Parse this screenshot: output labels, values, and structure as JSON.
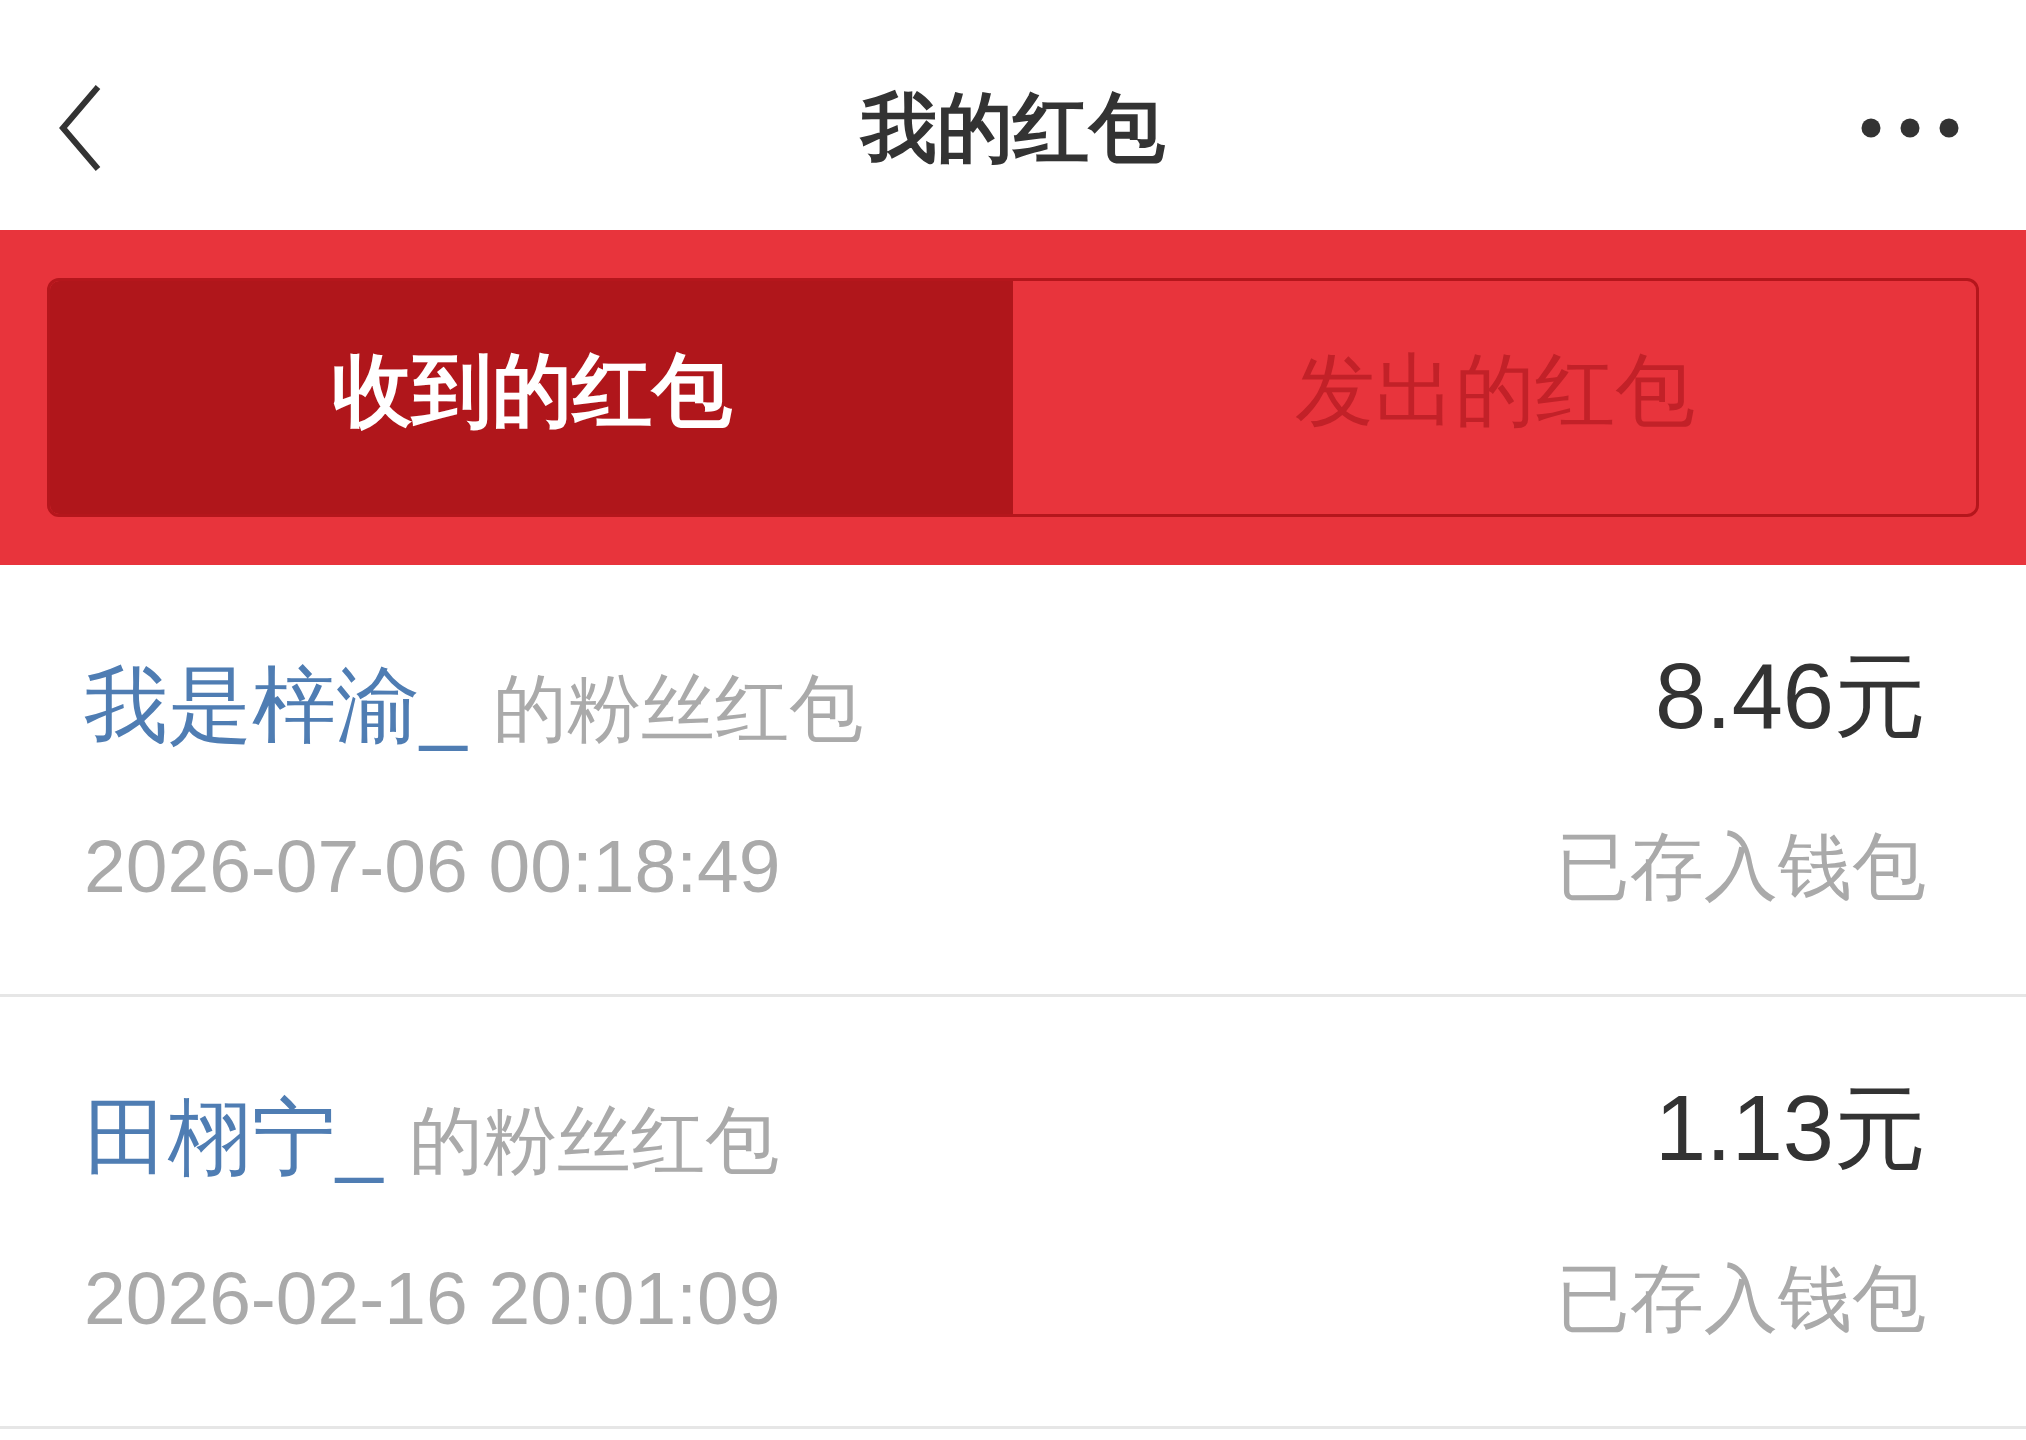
{
  "header": {
    "title": "我的红包"
  },
  "tabs": [
    {
      "label": "收到的红包",
      "selected": true
    },
    {
      "label": "发出的红包",
      "selected": false
    }
  ],
  "records": [
    {
      "sender": "我是梓渝_",
      "description": "的粉丝红包",
      "amount": "8.46元",
      "time": "2026-07-06 00:18:49",
      "status": "已存入钱包"
    },
    {
      "sender": "田栩宁_",
      "description": "的粉丝红包",
      "amount": "1.13元",
      "time": "2026-02-16 20:01:09",
      "status": "已存入钱包"
    }
  ]
}
